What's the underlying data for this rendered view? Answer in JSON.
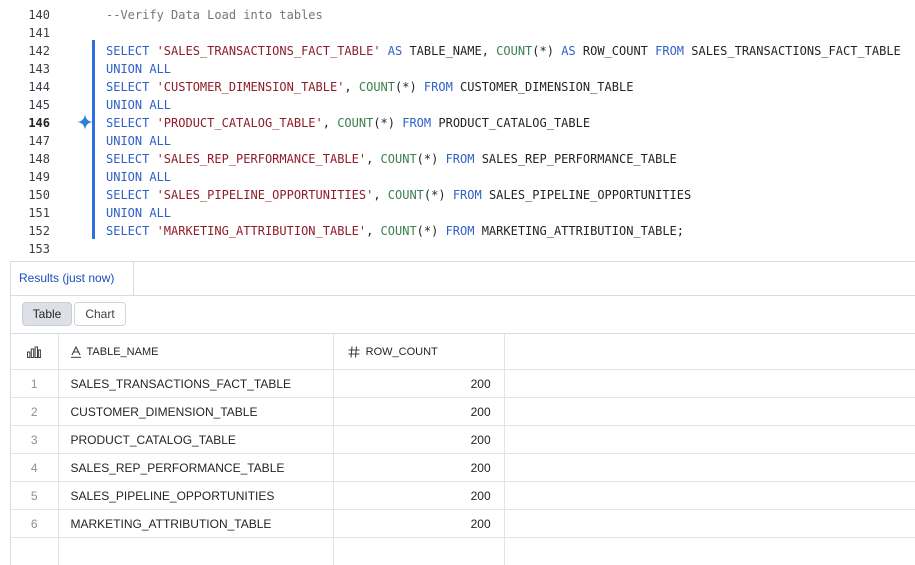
{
  "editor": {
    "lines": [
      {
        "num": "140",
        "tokens": [
          {
            "t": "--Verify Data Load into tables",
            "c": "comment"
          }
        ]
      },
      {
        "num": "141",
        "tokens": []
      },
      {
        "num": "142",
        "tokens": [
          {
            "t": "SELECT ",
            "c": "kw"
          },
          {
            "t": "'SALES_TRANSACTIONS_FACT_TABLE'",
            "c": "str"
          },
          {
            "t": " ",
            "c": ""
          },
          {
            "t": "AS",
            "c": "kw"
          },
          {
            "t": " TABLE_NAME, ",
            "c": ""
          },
          {
            "t": "COUNT",
            "c": "fn"
          },
          {
            "t": "(*) ",
            "c": ""
          },
          {
            "t": "AS",
            "c": "kw"
          },
          {
            "t": " ROW_COUNT ",
            "c": ""
          },
          {
            "t": "FROM",
            "c": "kw"
          },
          {
            "t": " SALES_TRANSACTIONS_FACT_TABLE",
            "c": ""
          }
        ]
      },
      {
        "num": "143",
        "tokens": [
          {
            "t": "UNION ALL",
            "c": "kw"
          }
        ]
      },
      {
        "num": "144",
        "tokens": [
          {
            "t": "SELECT ",
            "c": "kw"
          },
          {
            "t": "'CUSTOMER_DIMENSION_TABLE'",
            "c": "str"
          },
          {
            "t": ", ",
            "c": ""
          },
          {
            "t": "COUNT",
            "c": "fn"
          },
          {
            "t": "(*) ",
            "c": ""
          },
          {
            "t": "FROM",
            "c": "kw"
          },
          {
            "t": " CUSTOMER_DIMENSION_TABLE",
            "c": ""
          }
        ]
      },
      {
        "num": "145",
        "tokens": [
          {
            "t": "UNION ALL",
            "c": "kw"
          }
        ]
      },
      {
        "num": "146",
        "tokens": [
          {
            "t": "SELECT ",
            "c": "kw"
          },
          {
            "t": "'PRODUCT_CATALOG_TABLE'",
            "c": "str"
          },
          {
            "t": ", ",
            "c": ""
          },
          {
            "t": "COUNT",
            "c": "fn"
          },
          {
            "t": "(*) ",
            "c": ""
          },
          {
            "t": "FROM",
            "c": "kw"
          },
          {
            "t": " PRODUCT_CATALOG_TABLE",
            "c": ""
          }
        ]
      },
      {
        "num": "147",
        "tokens": [
          {
            "t": "UNION ALL",
            "c": "kw"
          }
        ]
      },
      {
        "num": "148",
        "tokens": [
          {
            "t": "SELECT ",
            "c": "kw"
          },
          {
            "t": "'SALES_REP_PERFORMANCE_TABLE'",
            "c": "str"
          },
          {
            "t": ", ",
            "c": ""
          },
          {
            "t": "COUNT",
            "c": "fn"
          },
          {
            "t": "(*) ",
            "c": ""
          },
          {
            "t": "FROM",
            "c": "kw"
          },
          {
            "t": " SALES_REP_PERFORMANCE_TABLE",
            "c": ""
          }
        ]
      },
      {
        "num": "149",
        "tokens": [
          {
            "t": "UNION ALL",
            "c": "kw"
          }
        ]
      },
      {
        "num": "150",
        "tokens": [
          {
            "t": "SELECT ",
            "c": "kw"
          },
          {
            "t": "'SALES_PIPELINE_OPPORTUNITIES'",
            "c": "str"
          },
          {
            "t": ", ",
            "c": ""
          },
          {
            "t": "COUNT",
            "c": "fn"
          },
          {
            "t": "(*) ",
            "c": ""
          },
          {
            "t": "FROM",
            "c": "kw"
          },
          {
            "t": " SALES_PIPELINE_OPPORTUNITIES",
            "c": ""
          }
        ]
      },
      {
        "num": "151",
        "tokens": [
          {
            "t": "UNION ALL",
            "c": "kw"
          }
        ]
      },
      {
        "num": "152",
        "tokens": [
          {
            "t": "SELECT ",
            "c": "kw"
          },
          {
            "t": "'MARKETING_ATTRIBUTION_TABLE'",
            "c": "str"
          },
          {
            "t": ", ",
            "c": ""
          },
          {
            "t": "COUNT",
            "c": "fn"
          },
          {
            "t": "(*) ",
            "c": ""
          },
          {
            "t": "FROM",
            "c": "kw"
          },
          {
            "t": " MARKETING_ATTRIBUTION_TABLE;",
            "c": ""
          }
        ]
      },
      {
        "num": "153",
        "tokens": []
      }
    ],
    "active_line": "146"
  },
  "results": {
    "tab_label": "Results (just now)",
    "view_toggle": {
      "table_label": "Table",
      "chart_label": "Chart",
      "selected": "Table"
    },
    "columns": [
      {
        "name": "TABLE_NAME",
        "type_icon": "text-type-icon"
      },
      {
        "name": "ROW_COUNT",
        "type_icon": "number-type-icon"
      }
    ],
    "rows": [
      {
        "idx": "1",
        "table_name": "SALES_TRANSACTIONS_FACT_TABLE",
        "row_count": "200"
      },
      {
        "idx": "2",
        "table_name": "CUSTOMER_DIMENSION_TABLE",
        "row_count": "200"
      },
      {
        "idx": "3",
        "table_name": "PRODUCT_CATALOG_TABLE",
        "row_count": "200"
      },
      {
        "idx": "4",
        "table_name": "SALES_REP_PERFORMANCE_TABLE",
        "row_count": "200"
      },
      {
        "idx": "5",
        "table_name": "SALES_PIPELINE_OPPORTUNITIES",
        "row_count": "200"
      },
      {
        "idx": "6",
        "table_name": "MARKETING_ATTRIBUTION_TABLE",
        "row_count": "200"
      }
    ]
  },
  "colors": {
    "keyword": "#2f61c7",
    "string": "#8f1d2a",
    "function": "#3b7f50",
    "comment": "#6e7781",
    "active_bar": "#2f6fe0",
    "results_tab_text": "#1a4fb8"
  }
}
